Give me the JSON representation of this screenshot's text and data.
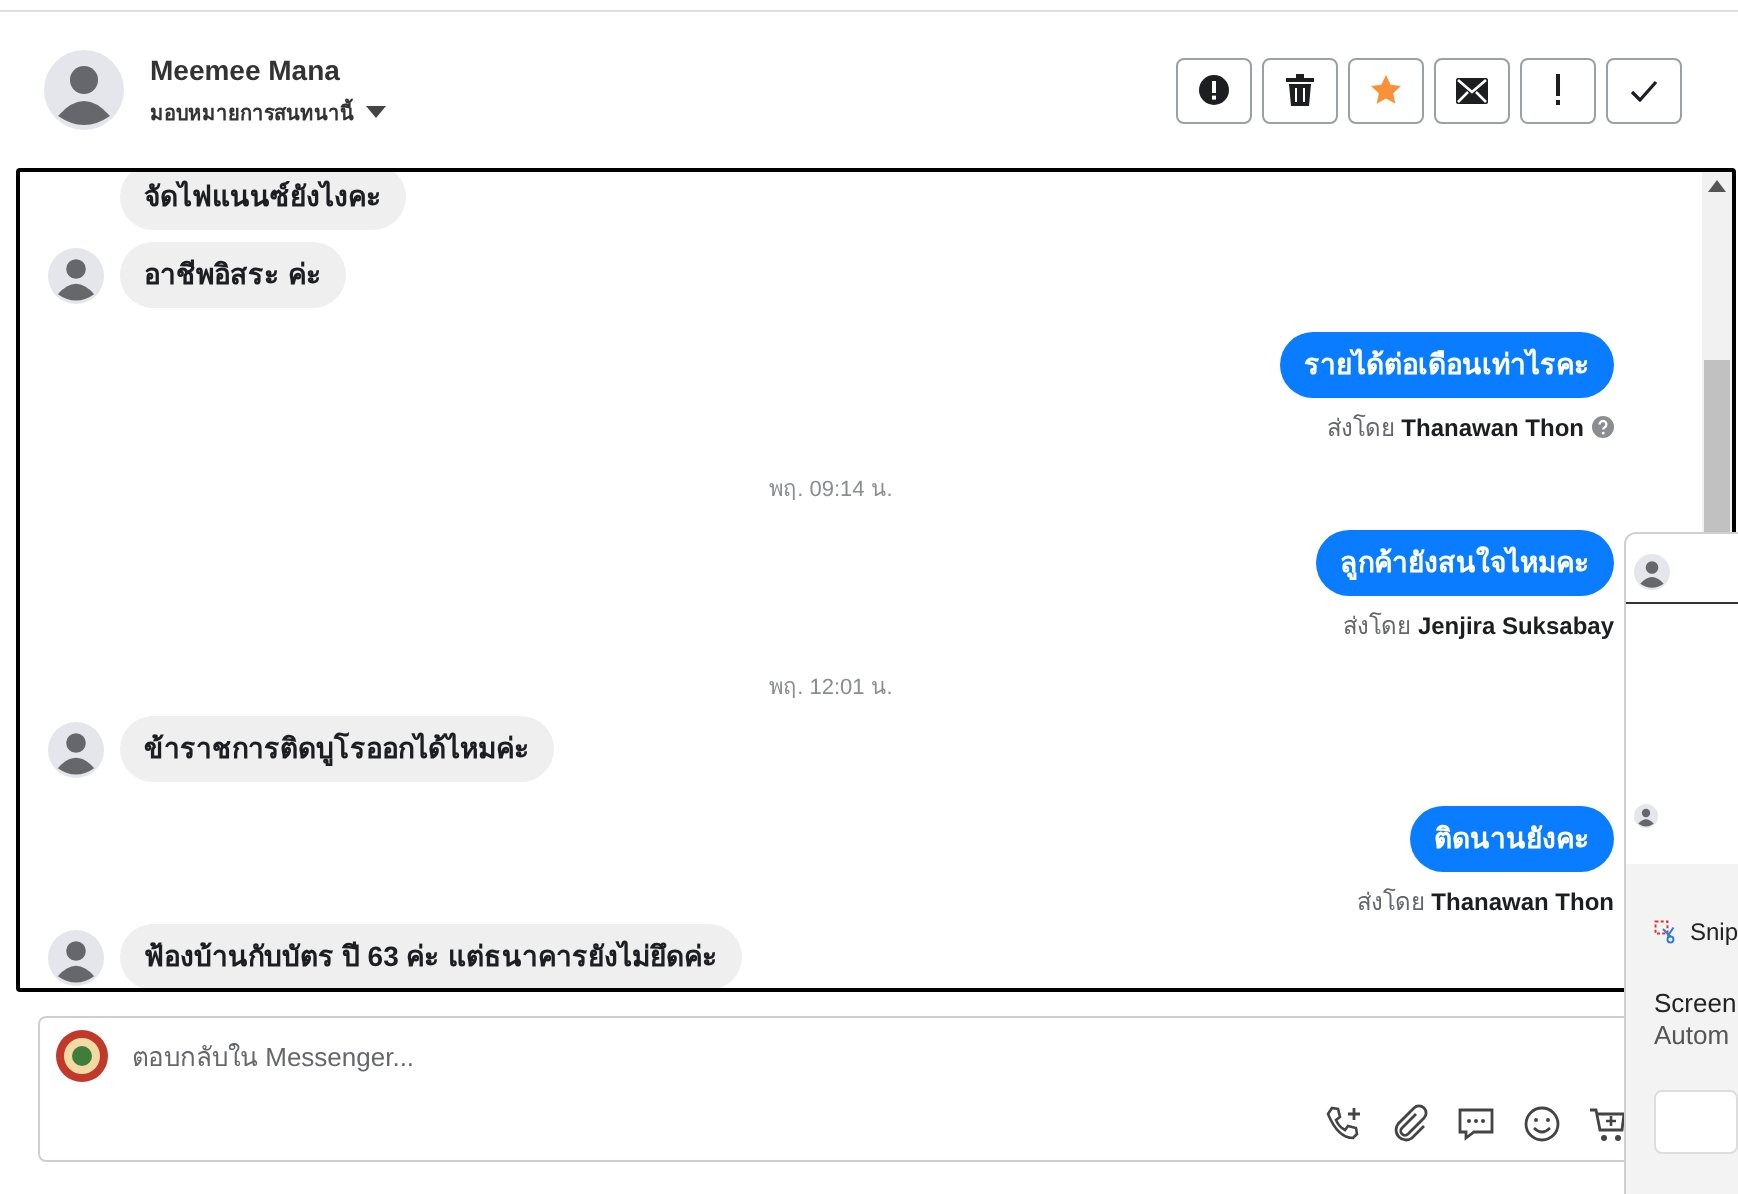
{
  "header": {
    "name": "Meemee Mana",
    "assign_label": "มอบหมายการสนทนานี้"
  },
  "actions": [
    {
      "kind": "alert"
    },
    {
      "kind": "trash"
    },
    {
      "kind": "star",
      "on": true
    },
    {
      "kind": "mail"
    },
    {
      "kind": "important"
    },
    {
      "kind": "done"
    }
  ],
  "messages": [
    {
      "kind": "incoming",
      "text": "จัดไฟแนนซ์ยังไงคะ",
      "avatar": false
    },
    {
      "kind": "incoming",
      "text": "อาชีพอิสระ ค่ะ",
      "avatar": true
    },
    {
      "kind": "outgoing",
      "text": "รายได้ต่อเดือนเท่าไรคะ",
      "sent_by": "ส่งโดย",
      "sender": "Thanawan Thon",
      "help": true
    },
    {
      "kind": "time",
      "text": "พฤ. 09:14 น."
    },
    {
      "kind": "outgoing",
      "text": "ลูกค้ายังสนใจไหมคะ",
      "sent_by": "ส่งโดย",
      "sender": "Jenjira Suksabay",
      "help": false
    },
    {
      "kind": "time",
      "text": "พฤ. 12:01 น."
    },
    {
      "kind": "incoming",
      "text": "ข้าราชการติดบูโรออกได้ไหมค่ะ",
      "avatar": true
    },
    {
      "kind": "outgoing",
      "text": "ติดนานยังคะ",
      "sent_by": "ส่งโดย",
      "sender": "Thanawan Thon",
      "help": false
    },
    {
      "kind": "incoming",
      "text": "ฟ้องบ้านกับบัตร ปี 63 ค่ะ แต่ธนาคารยังไม่ยึดค่ะ",
      "avatar": true
    }
  ],
  "composer": {
    "placeholder": "ตอบกลับใน Messenger...",
    "tools": [
      {
        "kind": "call"
      },
      {
        "kind": "attach"
      },
      {
        "kind": "reply"
      },
      {
        "kind": "emoji"
      },
      {
        "kind": "cart"
      }
    ]
  },
  "notification": {
    "app": "Snip",
    "title": "Screen",
    "subtitle": "Autom"
  }
}
